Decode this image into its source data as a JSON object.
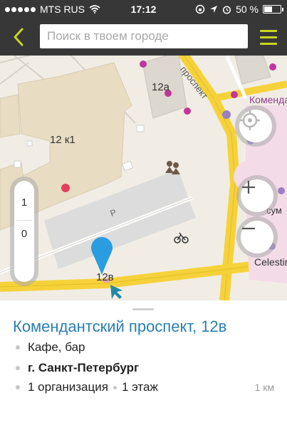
{
  "status_bar": {
    "carrier": "MTS RUS",
    "time": "17:12",
    "battery_percent": "50 %",
    "battery_level": 0.5
  },
  "toolbar": {
    "search_placeholder": "Поиск в твоем городе"
  },
  "map": {
    "labels": {
      "building_12a": "12а",
      "building_12k1": "12 к1",
      "building_12v": "12в",
      "street": "проспект",
      "street_right": "Комендан",
      "parking": "P",
      "place_sum": "сум",
      "place_celestin": "Celestin"
    },
    "floor_levels": [
      "1",
      "0"
    ]
  },
  "card": {
    "title": "Комендантский проспект, 12в",
    "category": "Кафе, бар",
    "city": "г. Санкт-Петербург",
    "organizations": "1 организация",
    "floors": "1 этаж",
    "distance": "1 км"
  },
  "colors": {
    "toolbar_bg": "#373737",
    "accent_green": "#c7d61f",
    "title_blue": "#2a7fb0",
    "road_yellow": "#f6d23a",
    "pin_blue": "#2a9de0"
  }
}
